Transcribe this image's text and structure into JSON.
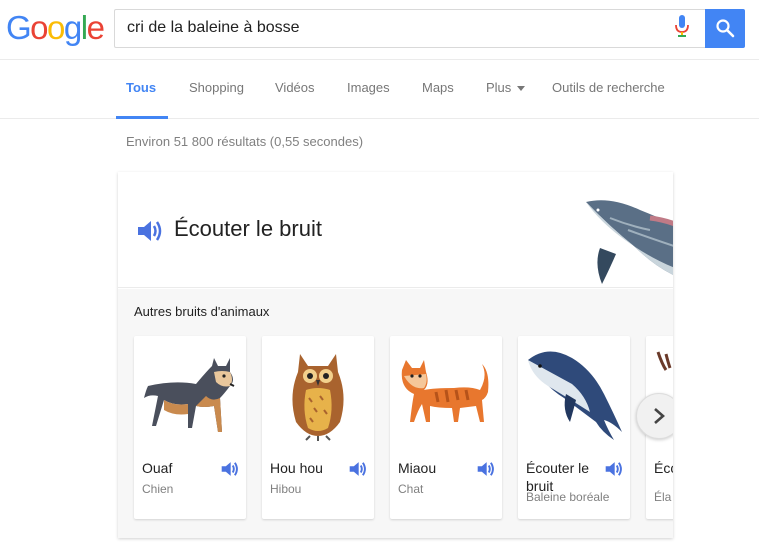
{
  "logo": {
    "letters": [
      "G",
      "o",
      "o",
      "g",
      "l",
      "e"
    ],
    "colors": [
      "#4285f4",
      "#ea4335",
      "#fbbc05",
      "#4285f4",
      "#34a853",
      "#ea4335"
    ]
  },
  "search": {
    "query": "cri de la baleine à bosse"
  },
  "tabs": [
    {
      "label": "Tous",
      "active": true
    },
    {
      "label": "Shopping"
    },
    {
      "label": "Vidéos"
    },
    {
      "label": "Images"
    },
    {
      "label": "Maps"
    },
    {
      "label": "Plus"
    },
    {
      "label": "Outils de recherche"
    }
  ],
  "result_stats": "Environ 51 800 résultats (0,55 secondes)",
  "card": {
    "title": "Écouter le bruit",
    "other_label": "Autres bruits d'animaux",
    "animals": [
      {
        "name": "Ouaf",
        "species": "Chien"
      },
      {
        "name": "Hou hou",
        "species": "Hibou"
      },
      {
        "name": "Miaou",
        "species": "Chat"
      },
      {
        "name": "Écouter le bruit",
        "species": "Baleine boréale"
      },
      {
        "name": "Éco bru",
        "species": "Éla"
      }
    ]
  },
  "colors": {
    "accent": "#4285f4",
    "speaker": "#4a72e0"
  }
}
